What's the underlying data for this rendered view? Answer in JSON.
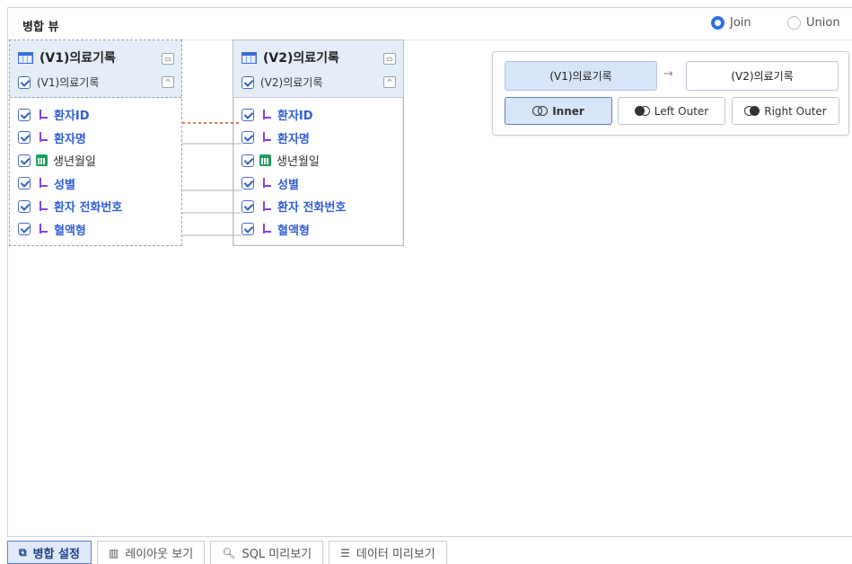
{
  "header": {
    "title": "병합 뷰",
    "join_label": "Join",
    "union_label": "Union",
    "selected_mode": "Join"
  },
  "tables": {
    "v1": {
      "title": "(V1)의료기록",
      "subtitle": "(V1)의료기록",
      "fields": [
        {
          "name": "환자ID",
          "type": "key"
        },
        {
          "name": "환자명",
          "type": "key"
        },
        {
          "name": "생년월일",
          "type": "date"
        },
        {
          "name": "성별",
          "type": "key"
        },
        {
          "name": "환자 전화번호",
          "type": "key"
        },
        {
          "name": "혈액형",
          "type": "key"
        }
      ]
    },
    "v2": {
      "title": "(V2)의료기록",
      "subtitle": "(V2)의료기록",
      "fields": [
        {
          "name": "환자ID",
          "type": "key"
        },
        {
          "name": "환자명",
          "type": "key"
        },
        {
          "name": "생년월일",
          "type": "date"
        },
        {
          "name": "성별",
          "type": "key"
        },
        {
          "name": "환자 전화번호",
          "type": "key"
        },
        {
          "name": "혈액형",
          "type": "key"
        }
      ]
    }
  },
  "join_config": {
    "left_table": "(V1)의료기록",
    "right_table": "(V2)의료기록",
    "arrow": "→",
    "types": [
      "Inner",
      "Left Outer",
      "Right Outer"
    ],
    "selected_type": "Inner"
  },
  "links": {
    "highlight_color": "#e8472f",
    "line_color": "#b0b4ba"
  },
  "tabs": [
    {
      "label": "병합 설정",
      "icon": "merge-icon",
      "active": true
    },
    {
      "label": "레이아웃 보기",
      "icon": "layout-icon",
      "active": false
    },
    {
      "label": "SQL 미리보기",
      "icon": "search-icon",
      "active": false
    },
    {
      "label": "데이터 미리보기",
      "icon": "list-icon",
      "active": false
    }
  ]
}
